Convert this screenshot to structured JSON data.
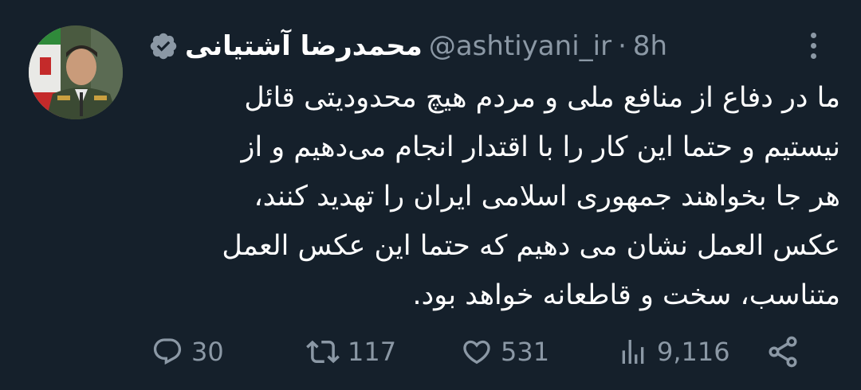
{
  "tweet": {
    "author_name": "محمدرضا آشتیانی",
    "handle": "@ashtiyani_ir",
    "separator": "·",
    "time": "8h",
    "body_lines": [
      "ما در دفاع از منافع ملی و مردم هیچ محدودیتی قائل",
      "نیستیم و حتما این کار را با اقتدار انجام می‌دهیم و از",
      "هر جا بخواهند جمهوری اسلامی ایران را تهدید کنند،",
      "عکس العمل نشان می دهیم که حتما این عکس العمل",
      "متناسب، سخت و قاطعانه خواهد بود."
    ]
  },
  "actions": {
    "replies": "30",
    "retweets": "117",
    "likes": "531",
    "views": "9,116"
  },
  "colors": {
    "background": "#15202b",
    "text": "#ffffff",
    "muted": "#8b98a5",
    "badge": "#8b98a5"
  }
}
